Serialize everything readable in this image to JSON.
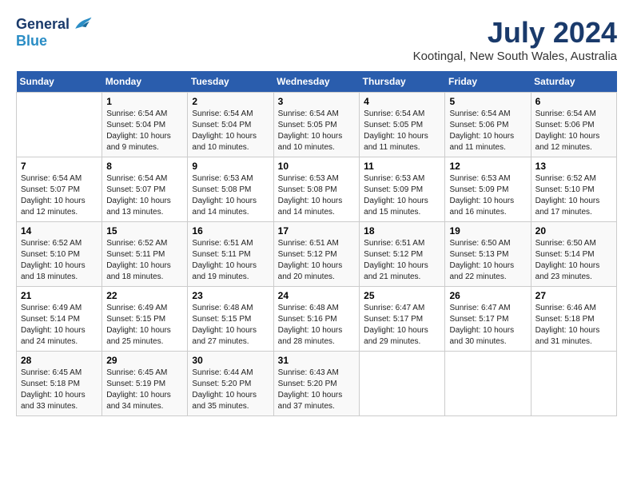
{
  "header": {
    "logo_line1": "General",
    "logo_line2": "Blue",
    "month_title": "July 2024",
    "location": "Kootingal, New South Wales, Australia"
  },
  "days_of_week": [
    "Sunday",
    "Monday",
    "Tuesday",
    "Wednesday",
    "Thursday",
    "Friday",
    "Saturday"
  ],
  "weeks": [
    [
      {
        "day": "",
        "info": ""
      },
      {
        "day": "1",
        "info": "Sunrise: 6:54 AM\nSunset: 5:04 PM\nDaylight: 10 hours\nand 9 minutes."
      },
      {
        "day": "2",
        "info": "Sunrise: 6:54 AM\nSunset: 5:04 PM\nDaylight: 10 hours\nand 10 minutes."
      },
      {
        "day": "3",
        "info": "Sunrise: 6:54 AM\nSunset: 5:05 PM\nDaylight: 10 hours\nand 10 minutes."
      },
      {
        "day": "4",
        "info": "Sunrise: 6:54 AM\nSunset: 5:05 PM\nDaylight: 10 hours\nand 11 minutes."
      },
      {
        "day": "5",
        "info": "Sunrise: 6:54 AM\nSunset: 5:06 PM\nDaylight: 10 hours\nand 11 minutes."
      },
      {
        "day": "6",
        "info": "Sunrise: 6:54 AM\nSunset: 5:06 PM\nDaylight: 10 hours\nand 12 minutes."
      }
    ],
    [
      {
        "day": "7",
        "info": "Sunrise: 6:54 AM\nSunset: 5:07 PM\nDaylight: 10 hours\nand 12 minutes."
      },
      {
        "day": "8",
        "info": "Sunrise: 6:54 AM\nSunset: 5:07 PM\nDaylight: 10 hours\nand 13 minutes."
      },
      {
        "day": "9",
        "info": "Sunrise: 6:53 AM\nSunset: 5:08 PM\nDaylight: 10 hours\nand 14 minutes."
      },
      {
        "day": "10",
        "info": "Sunrise: 6:53 AM\nSunset: 5:08 PM\nDaylight: 10 hours\nand 14 minutes."
      },
      {
        "day": "11",
        "info": "Sunrise: 6:53 AM\nSunset: 5:09 PM\nDaylight: 10 hours\nand 15 minutes."
      },
      {
        "day": "12",
        "info": "Sunrise: 6:53 AM\nSunset: 5:09 PM\nDaylight: 10 hours\nand 16 minutes."
      },
      {
        "day": "13",
        "info": "Sunrise: 6:52 AM\nSunset: 5:10 PM\nDaylight: 10 hours\nand 17 minutes."
      }
    ],
    [
      {
        "day": "14",
        "info": "Sunrise: 6:52 AM\nSunset: 5:10 PM\nDaylight: 10 hours\nand 18 minutes."
      },
      {
        "day": "15",
        "info": "Sunrise: 6:52 AM\nSunset: 5:11 PM\nDaylight: 10 hours\nand 18 minutes."
      },
      {
        "day": "16",
        "info": "Sunrise: 6:51 AM\nSunset: 5:11 PM\nDaylight: 10 hours\nand 19 minutes."
      },
      {
        "day": "17",
        "info": "Sunrise: 6:51 AM\nSunset: 5:12 PM\nDaylight: 10 hours\nand 20 minutes."
      },
      {
        "day": "18",
        "info": "Sunrise: 6:51 AM\nSunset: 5:12 PM\nDaylight: 10 hours\nand 21 minutes."
      },
      {
        "day": "19",
        "info": "Sunrise: 6:50 AM\nSunset: 5:13 PM\nDaylight: 10 hours\nand 22 minutes."
      },
      {
        "day": "20",
        "info": "Sunrise: 6:50 AM\nSunset: 5:14 PM\nDaylight: 10 hours\nand 23 minutes."
      }
    ],
    [
      {
        "day": "21",
        "info": "Sunrise: 6:49 AM\nSunset: 5:14 PM\nDaylight: 10 hours\nand 24 minutes."
      },
      {
        "day": "22",
        "info": "Sunrise: 6:49 AM\nSunset: 5:15 PM\nDaylight: 10 hours\nand 25 minutes."
      },
      {
        "day": "23",
        "info": "Sunrise: 6:48 AM\nSunset: 5:15 PM\nDaylight: 10 hours\nand 27 minutes."
      },
      {
        "day": "24",
        "info": "Sunrise: 6:48 AM\nSunset: 5:16 PM\nDaylight: 10 hours\nand 28 minutes."
      },
      {
        "day": "25",
        "info": "Sunrise: 6:47 AM\nSunset: 5:17 PM\nDaylight: 10 hours\nand 29 minutes."
      },
      {
        "day": "26",
        "info": "Sunrise: 6:47 AM\nSunset: 5:17 PM\nDaylight: 10 hours\nand 30 minutes."
      },
      {
        "day": "27",
        "info": "Sunrise: 6:46 AM\nSunset: 5:18 PM\nDaylight: 10 hours\nand 31 minutes."
      }
    ],
    [
      {
        "day": "28",
        "info": "Sunrise: 6:45 AM\nSunset: 5:18 PM\nDaylight: 10 hours\nand 33 minutes."
      },
      {
        "day": "29",
        "info": "Sunrise: 6:45 AM\nSunset: 5:19 PM\nDaylight: 10 hours\nand 34 minutes."
      },
      {
        "day": "30",
        "info": "Sunrise: 6:44 AM\nSunset: 5:20 PM\nDaylight: 10 hours\nand 35 minutes."
      },
      {
        "day": "31",
        "info": "Sunrise: 6:43 AM\nSunset: 5:20 PM\nDaylight: 10 hours\nand 37 minutes."
      },
      {
        "day": "",
        "info": ""
      },
      {
        "day": "",
        "info": ""
      },
      {
        "day": "",
        "info": ""
      }
    ]
  ]
}
